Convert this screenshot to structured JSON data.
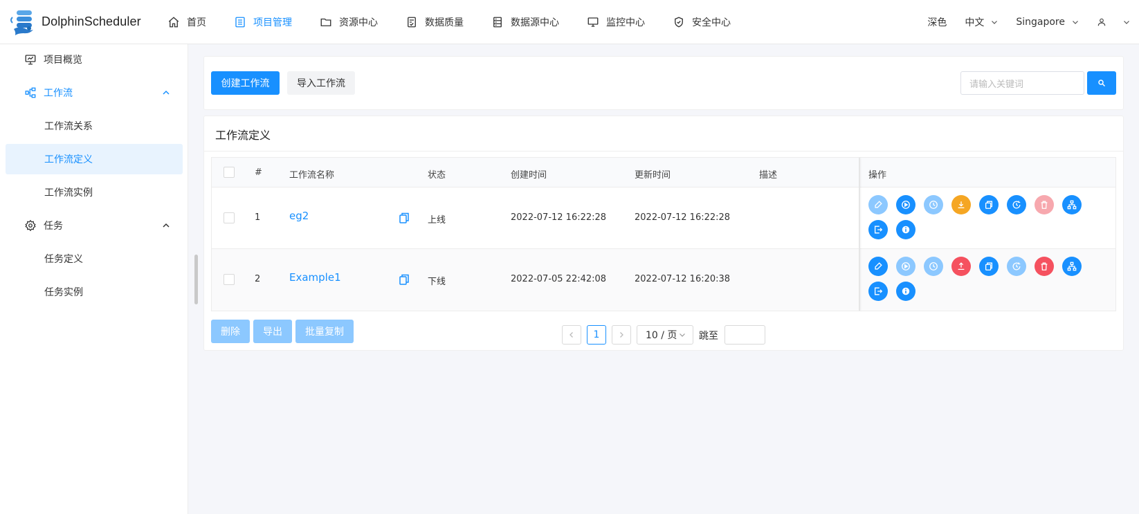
{
  "app": {
    "name": "DolphinScheduler"
  },
  "nav": [
    {
      "label": "首页",
      "icon": "home-icon"
    },
    {
      "label": "项目管理",
      "icon": "list-icon",
      "active": true
    },
    {
      "label": "资源中心",
      "icon": "folder-icon"
    },
    {
      "label": "数据质量",
      "icon": "document-check-icon"
    },
    {
      "label": "数据源中心",
      "icon": "server-icon"
    },
    {
      "label": "监控中心",
      "icon": "monitor-icon"
    },
    {
      "label": "安全中心",
      "icon": "shield-check-icon"
    }
  ],
  "top_right": {
    "theme": "深色",
    "language": "中文",
    "timezone": "Singapore"
  },
  "sidebar": {
    "items": [
      {
        "label": "项目概览",
        "icon": "presentation-icon"
      },
      {
        "label": "工作流",
        "icon": "workflow-icon",
        "expanded": true
      },
      {
        "label": "工作流关系"
      },
      {
        "label": "工作流定义",
        "selected": true
      },
      {
        "label": "工作流实例"
      },
      {
        "label": "任务",
        "icon": "gear-icon",
        "expanded": true
      },
      {
        "label": "任务定义"
      },
      {
        "label": "任务实例"
      }
    ]
  },
  "toolbar": {
    "create_label": "创建工作流",
    "import_label": "导入工作流",
    "search_placeholder": "请输入关键词"
  },
  "section": {
    "title": "工作流定义"
  },
  "table": {
    "headers": {
      "index": "#",
      "name": "工作流名称",
      "status": "状态",
      "created": "创建时间",
      "updated": "更新时间",
      "description": "描述",
      "operation": "操作"
    },
    "rows": [
      {
        "index": "1",
        "name": "eg2",
        "status": "上线",
        "created": "2022-07-12 16:22:28",
        "updated": "2022-07-12 16:22:28",
        "description": ""
      },
      {
        "index": "2",
        "name": "Example1",
        "status": "下线",
        "created": "2022-07-05 22:42:08",
        "updated": "2022-07-12 16:20:38",
        "description": ""
      }
    ]
  },
  "batch": {
    "delete_label": "删除",
    "export_label": "导出",
    "copy_label": "批量复制"
  },
  "pagination": {
    "current": "1",
    "page_size": "10 / 页",
    "jump_label": "跳至"
  },
  "colors": {
    "primary": "#1890ff",
    "primary_light": "#8cc8ff",
    "warning": "#f5a623",
    "danger": "#f5515f",
    "danger_light": "#f7a8ae"
  }
}
